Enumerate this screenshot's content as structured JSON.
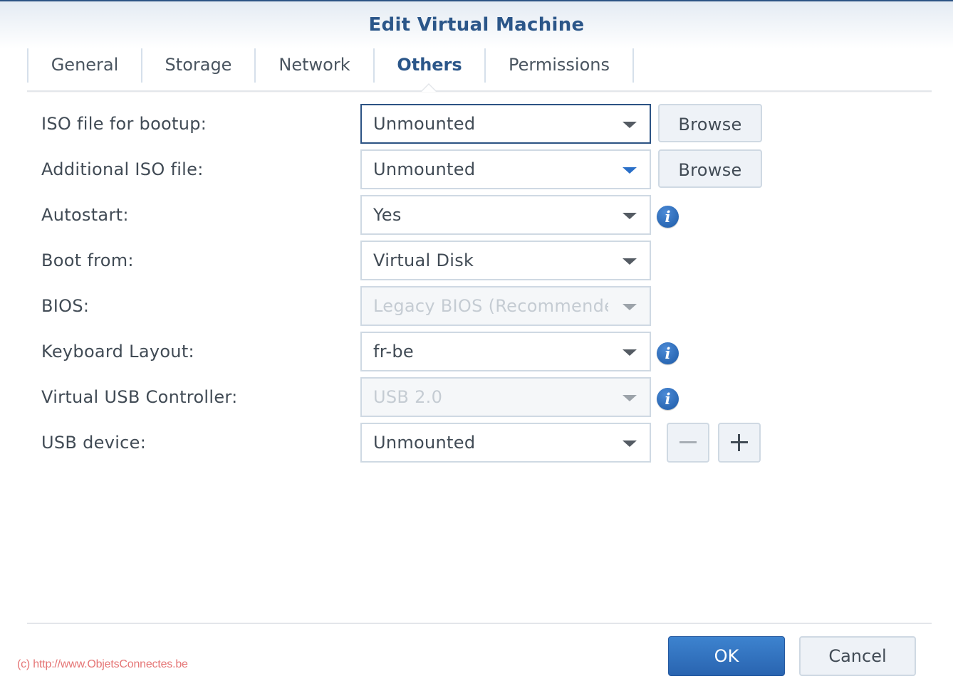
{
  "dialog": {
    "title": "Edit Virtual Machine"
  },
  "tabs": [
    {
      "label": "General",
      "active": false
    },
    {
      "label": "Storage",
      "active": false
    },
    {
      "label": "Network",
      "active": false
    },
    {
      "label": "Others",
      "active": true
    },
    {
      "label": "Permissions",
      "active": false
    }
  ],
  "form": {
    "iso_bootup": {
      "label": "ISO file for bootup:",
      "value": "Unmounted",
      "browse_label": "Browse"
    },
    "additional_iso": {
      "label": "Additional ISO file:",
      "value": "Unmounted",
      "browse_label": "Browse"
    },
    "autostart": {
      "label": "Autostart:",
      "value": "Yes",
      "info_glyph": "i"
    },
    "boot_from": {
      "label": "Boot from:",
      "value": "Virtual Disk"
    },
    "bios": {
      "label": "BIOS:",
      "value": "Legacy BIOS (Recommended)",
      "disabled": true
    },
    "keyboard_layout": {
      "label": "Keyboard Layout:",
      "value": "fr-be",
      "info_glyph": "i"
    },
    "usb_controller": {
      "label": "Virtual USB Controller:",
      "value": "USB 2.0",
      "disabled": true,
      "info_glyph": "i"
    },
    "usb_device": {
      "label": "USB device:",
      "value": "Unmounted"
    }
  },
  "footer": {
    "ok_label": "OK",
    "cancel_label": "Cancel",
    "watermark": "(c) http://www.ObjetsConnectes.be"
  },
  "colors": {
    "accent": "#2b5689",
    "primary_button": "#2f6dbd",
    "watermark": "#e57575"
  }
}
